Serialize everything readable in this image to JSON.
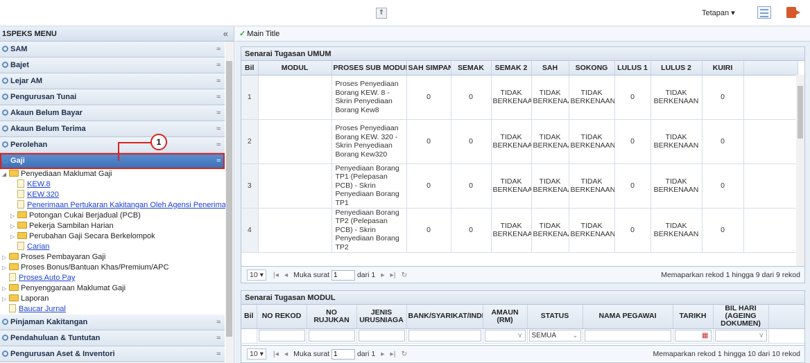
{
  "topbar": {
    "collapse_glyph": "⇑",
    "settings_label": "Tetapan ▾",
    "list_icon": "list-icon",
    "exit_icon": "exit-icon"
  },
  "sidebar": {
    "title": "1SPEKS MENU",
    "collapse_glyph": "«",
    "items_top": [
      {
        "label": "SAM"
      },
      {
        "label": "Bajet"
      },
      {
        "label": "Lejar AM"
      },
      {
        "label": "Pengurusan Tunai"
      },
      {
        "label": "Akaun Belum Bayar"
      },
      {
        "label": "Akaun Belum Terima"
      },
      {
        "label": "Perolehan"
      }
    ],
    "active_item": {
      "label": "Gaji"
    },
    "tree": [
      {
        "type": "folder",
        "level": 0,
        "label": "Penyediaan Maklumat Gaji",
        "open": true
      },
      {
        "type": "link",
        "level": 1,
        "label": "KEW.8"
      },
      {
        "type": "link",
        "level": 1,
        "label": "KEW.320"
      },
      {
        "type": "link",
        "level": 1,
        "label": "Penerimaan Pertukaran Kakitangan Oleh Agensi Penerima"
      },
      {
        "type": "folder",
        "level": 1,
        "label": "Potongan Cukai Berjadual (PCB)"
      },
      {
        "type": "folder",
        "level": 1,
        "label": "Pekerja Sambilan Harian"
      },
      {
        "type": "folder",
        "level": 1,
        "label": "Perubahan Gaji Secara Berkelompok"
      },
      {
        "type": "link",
        "level": 1,
        "label": "Carian"
      },
      {
        "type": "folder",
        "level": 0,
        "label": "Proses Pembayaran Gaji"
      },
      {
        "type": "folder",
        "level": 0,
        "label": "Proses Bonus/Bantuan Khas/Premium/APC"
      },
      {
        "type": "link",
        "level": 0,
        "label": "Proses Auto Pay"
      },
      {
        "type": "folder",
        "level": 0,
        "label": "Penyenggaraan Maklumat Gaji"
      },
      {
        "type": "folder",
        "level": 0,
        "label": "Laporan"
      },
      {
        "type": "link",
        "level": 0,
        "label": "Baucar Jurnal"
      }
    ],
    "items_bottom": [
      {
        "label": "Pinjaman Kakitangan"
      },
      {
        "label": "Pendahuluan & Tuntutan"
      },
      {
        "label": "Pengurusan Aset & Inventori"
      }
    ],
    "callout": "1"
  },
  "main": {
    "title": "Main Title",
    "umum": {
      "title": "Senarai Tugasan UMUM",
      "columns": [
        "Bil",
        "MODUL",
        "PROSES SUB MODUL",
        "SAH SIMPAN",
        "SEMAK",
        "SEMAK 2",
        "SAH",
        "SOKONG",
        "LULUS 1",
        "LULUS 2",
        "KUIRI"
      ],
      "rows": [
        {
          "bil": "1",
          "modul": "",
          "proses": "Proses Penyediaan Borang KEW. 8 - Skrin Penyediaan Borang Kew8",
          "sah_simpan": "0",
          "semak": "0",
          "semak2": "TIDAK BERKENAAN",
          "sah": "TIDAK BERKENAAN",
          "sokong": "TIDAK BERKENAAN",
          "lulus1": "0",
          "lulus2": "TIDAK BERKENAAN",
          "kuiri": "0"
        },
        {
          "bil": "2",
          "modul": "",
          "proses": "Proses Penyediaan Borang KEW. 320 - Skrin Penyediaan Borang Kew320",
          "sah_simpan": "0",
          "semak": "0",
          "semak2": "TIDAK BERKENAAN",
          "sah": "TIDAK BERKENAAN",
          "sokong": "TIDAK BERKENAAN",
          "lulus1": "0",
          "lulus2": "TIDAK BERKENAAN",
          "kuiri": "0"
        },
        {
          "bil": "3",
          "modul": "",
          "proses": "Penyediaan Borang TP1 (Pelepasan PCB) - Skrin Penyediaan Borang TP1",
          "sah_simpan": "0",
          "semak": "0",
          "semak2": "TIDAK BERKENAAN",
          "sah": "TIDAK BERKENAAN",
          "sokong": "TIDAK BERKENAAN",
          "lulus1": "0",
          "lulus2": "TIDAK BERKENAAN",
          "kuiri": "0"
        },
        {
          "bil": "4",
          "modul": "",
          "proses": "Penyediaan Borang TP2 (Pelepasan PCB) - Skrin Penyediaan Borang TP2",
          "sah_simpan": "0",
          "semak": "0",
          "semak2": "TIDAK BERKENAAN",
          "sah": "TIDAK BERKENAAN",
          "sokong": "TIDAK BERKENAAN",
          "lulus1": "0",
          "lulus2": "TIDAK BERKENAAN",
          "kuiri": "0"
        }
      ],
      "pager": {
        "page_size": "10 ▾",
        "first": "|◂",
        "prev": "◂",
        "page_label": "Muka surat",
        "page_value": "1",
        "of_label": "dari 1",
        "next": "▸",
        "last": "▸|",
        "refresh": "↻",
        "info": "Memaparkan rekod 1 hingga 9 dari 9 rekod"
      }
    },
    "modul": {
      "title": "Senarai Tugasan MODUL",
      "columns": [
        "Bil",
        "NO REKOD",
        "NO RUJUKAN",
        "JENIS URUSNIAGA",
        "BANK/SYARIKAT/INDIVIDU",
        "AMAUN (RM)",
        "STATUS",
        "NAMA PEGAWAI",
        "TARIKH",
        "BIL HARI (AGEING DOKUMEN)"
      ],
      "status_filter": "SEMUA",
      "pager": {
        "page_size": "10 ▾",
        "first": "|◂",
        "prev": "◂",
        "page_label": "Muka surat",
        "page_value": "1",
        "of_label": "dari 1",
        "next": "▸",
        "last": "▸|",
        "refresh": "↻",
        "info": "Memaparkan rekod 1 hingga 10 dari 10 rekod"
      }
    }
  }
}
